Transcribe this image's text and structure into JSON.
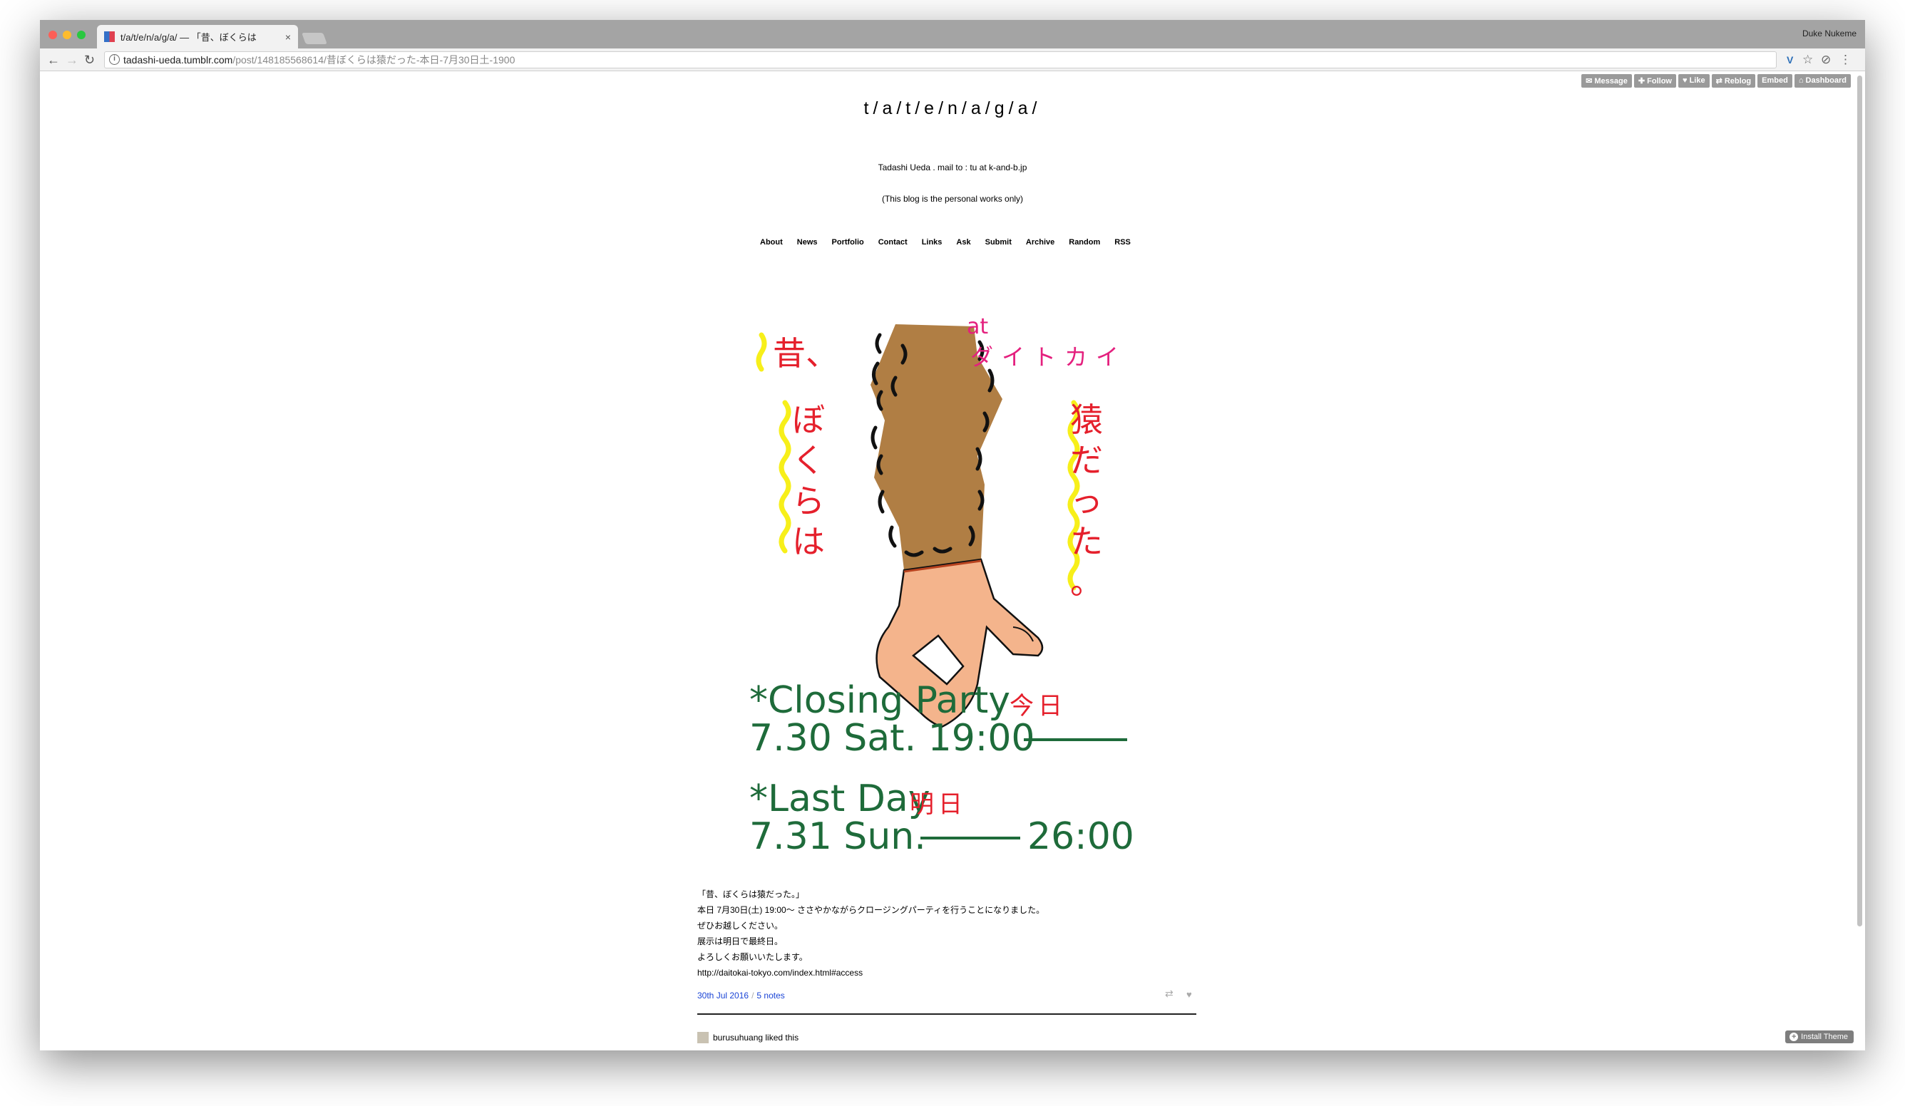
{
  "browser": {
    "tab_title": "t/a/t/e/n/a/g/a/ — 「昔、ぼくらは",
    "tab_close": "×",
    "profile_name": "Duke Nukeme",
    "url_host": "tadashi-ueda.tumblr.com",
    "url_path": "/post/148185568614/昔ぼくらは猿だった-本日-7月30日土-1900",
    "back": "←",
    "forward": "→",
    "reload": "↻",
    "info": "i",
    "star": "☆",
    "menu": "⋮",
    "ext_v": "V",
    "ext_shield": "⊘"
  },
  "tumblr_controls": [
    "Message",
    "Follow",
    "Like",
    "Reblog",
    "Embed",
    "Dashboard"
  ],
  "blog": {
    "title": "t/a/t/e/n/a/g/a/",
    "description_line1": "Tadashi Ueda . mail to : tu at k-and-b.jp",
    "description_line2": "(This blog is the personal works only)",
    "nav": [
      "About",
      "News",
      "Portfolio",
      "Contact",
      "Links",
      "Ask",
      "Submit",
      "Archive",
      "Random",
      "RSS"
    ]
  },
  "poster": {
    "mukashi": "昔、",
    "at": "at",
    "venue": "ダイトカイ",
    "bokura": [
      "ぼ",
      "く",
      "ら",
      "は"
    ],
    "saru": [
      "猿",
      "だ",
      "っ",
      "た",
      "。"
    ],
    "closing_party": "*Closing Party",
    "today": "今日",
    "closing_time": "7.30 Sat. 19:00",
    "last_day": "*Last Day",
    "tomorrow": "明日",
    "last_date": "7.31 Sun.",
    "last_time": "26:00",
    "colors": {
      "red": "#e5202c",
      "magenta": "#e4207e",
      "green": "#1e6b3a",
      "yellow": "#f7ef1a",
      "fur": "#b07e44",
      "skin": "#f4b48c"
    }
  },
  "post": {
    "caption": [
      "「昔、ぼくらは猿だった。」",
      "本日 7月30日(土) 19:00〜 ささやかながらクロージングパーティを行うことになりました。",
      "ぜひお越しください。",
      "展示は明日で最終日。",
      "よろしくお願いいたします。",
      "http://daitokai-tokyo.com/index.html#access"
    ],
    "date": "30th Jul 2016",
    "separator": "/",
    "notes": "5 notes",
    "reblog_icon": "⇄",
    "like_icon": "♥",
    "note_text": "burusuhuang liked this"
  },
  "install_theme": "Install Theme",
  "install_plus": "+"
}
